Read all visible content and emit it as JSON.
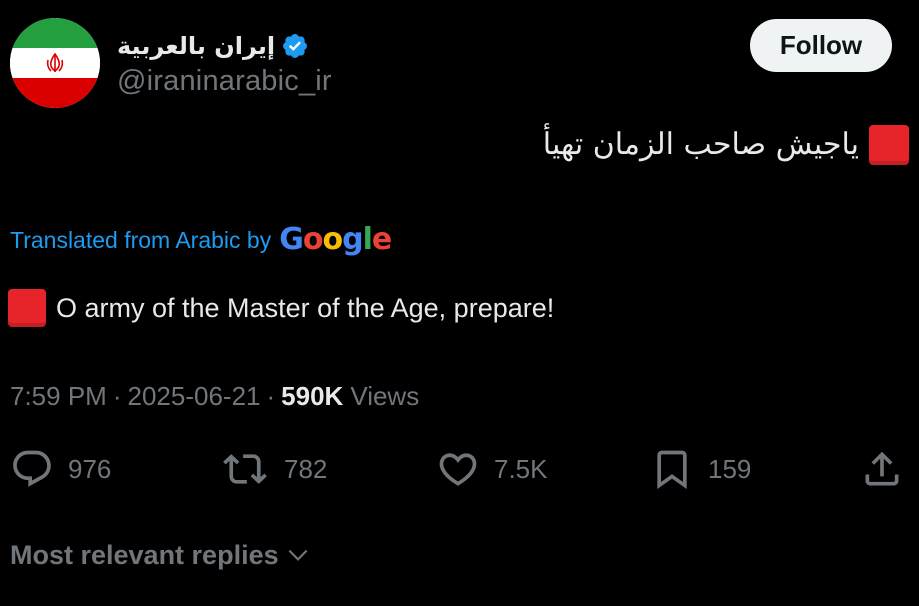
{
  "author": {
    "display_name": "إيران بالعربية",
    "handle": "@iraninarabic_ir",
    "verified": true,
    "verified_color": "#1d9bf0",
    "avatar": "iran-flag"
  },
  "follow_button": {
    "label": "Follow"
  },
  "post": {
    "original_text": "ياجيش صاحب الزمان تهيأ",
    "emoji": "red-square",
    "translated_label": "Translated from Arabic by",
    "translator_brand": "Google",
    "translated_text": "O army of the Master of the Age, prepare!"
  },
  "meta": {
    "time": "7:59 PM",
    "separator": "·",
    "date": "2025-06-21",
    "views_count": "590K",
    "views_label": "Views"
  },
  "actions": {
    "replies": "976",
    "reposts": "782",
    "likes": "7.5K",
    "bookmarks": "159"
  },
  "replies_sort": {
    "label": "Most relevant replies"
  },
  "colors": {
    "background": "#000000",
    "text_primary": "#e7e9ea",
    "text_secondary": "#71767b",
    "accent": "#1d9bf0",
    "follow_bg": "#eff3f4",
    "red_square": "#e8242b",
    "flag_green": "#239f40",
    "flag_red": "#da0000"
  }
}
